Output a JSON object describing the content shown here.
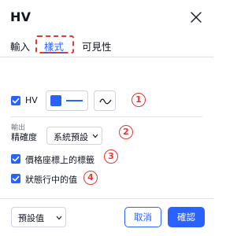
{
  "dialog": {
    "title": "HV",
    "close_icon": "close-icon"
  },
  "tabs": [
    {
      "label": "輸入",
      "active": false
    },
    {
      "label": "樣式",
      "active": true
    },
    {
      "label": "可見性",
      "active": false
    }
  ],
  "plot": {
    "checkbox_checked": true,
    "label": "HV",
    "color": "#2962ff",
    "style_icon": "line-style-icon"
  },
  "output": {
    "section_title": "輸出",
    "precision_label": "精確度",
    "precision_value": "系統預設",
    "price_scale_label": "價格座標上的標籤",
    "price_scale_checked": true,
    "status_line_label": "狀態行中的值",
    "status_line_checked": true
  },
  "footer": {
    "defaults_value": "預設值",
    "cancel_label": "取消",
    "ok_label": "確認"
  },
  "annotations": [
    "1",
    "2",
    "3",
    "4"
  ],
  "colors": {
    "accent": "#2962ff",
    "annotation": "#e53935"
  }
}
